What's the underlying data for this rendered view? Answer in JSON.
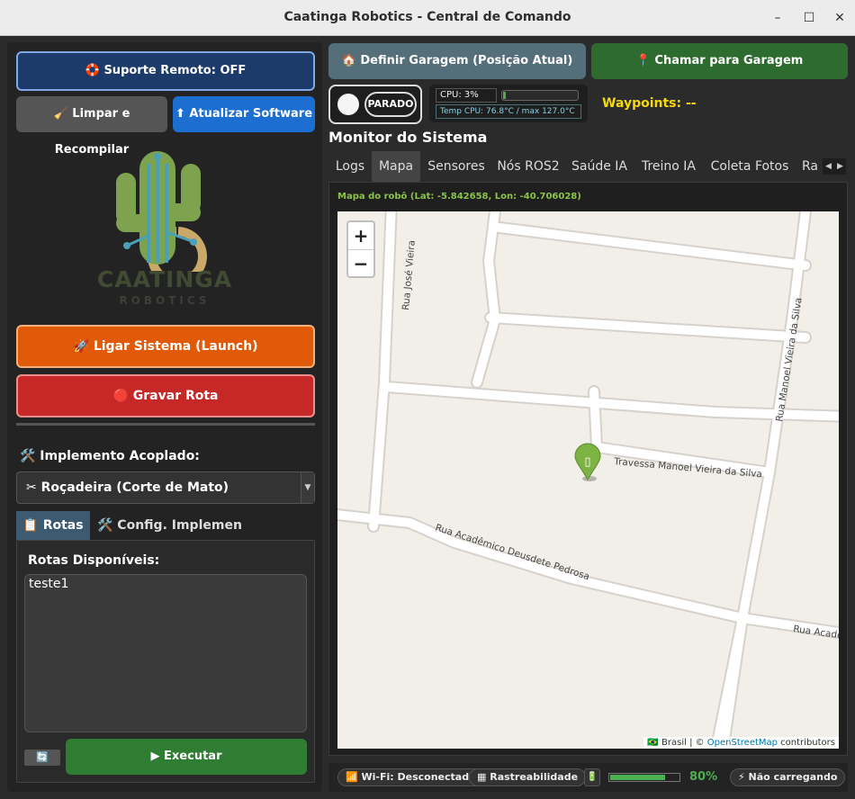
{
  "window": {
    "title": "Caatinga Robotics - Central de Comando",
    "minimize": "–",
    "maximize": "☐",
    "close": "✕"
  },
  "left": {
    "support_button": "🛟 Suporte Remoto: OFF",
    "clean_button": "🧹 Limpar e Recompilar",
    "update_button": "⬆ Atualizar Software",
    "logo": {
      "name": "CAATINGA",
      "sub": "ROBOTICS"
    },
    "launch_button": "🚀 Ligar Sistema (Launch)",
    "record_button": "🔴 Gravar Rota",
    "implement_label": "🛠️ Implemento Acoplado:",
    "implement_selected": "✂ Roçadeira (Corte de Mato)",
    "tabs": [
      {
        "label": "📋 Rotas"
      },
      {
        "label": "🛠️ Config. Implemento"
      }
    ],
    "routes_label": "Rotas Disponíveis:",
    "routes": [
      "teste1"
    ],
    "refresh_icon": "🔄",
    "execute_button": "▶ Executar"
  },
  "top": {
    "set_garage_button": "🏠 Definir Garagem (Posição Atual)",
    "call_garage_button": "📍 Chamar para Garagem"
  },
  "status": {
    "state": "PARADO",
    "cpu_label": "CPU: 3%",
    "cpu_percent": 3,
    "temp_label": "Temp CPU: 76.8°C / max 127.0°C",
    "waypoints": "Waypoints: --"
  },
  "monitor": {
    "title": "Monitor do Sistema",
    "tabs": [
      "Logs",
      "Mapa",
      "Sensores",
      "Nós ROS2",
      "Saúde IA",
      "Treino IA",
      "Coleta Fotos",
      "Ra"
    ],
    "active_tab": "Mapa",
    "scroll_left": "◀",
    "scroll_right": "▶"
  },
  "map": {
    "caption": "Mapa do robô (Lat: -5.842658, Lon: -40.706028)",
    "latitude": -5.842658,
    "longitude": -40.706028,
    "zoom_in": "+",
    "zoom_out": "−",
    "marker_glyph": "▯",
    "streets": {
      "s1": "Rua José Vieira",
      "s2": "Rua Manoel Vieira da Silva",
      "s3": "Travessa Manoel Vieira da Silva",
      "s4": "Rua Acadêmico Deusdete Pedrosa",
      "s5": "Rua Acade"
    },
    "attribution": {
      "prefix": "🇧🇷 Brasil | © ",
      "link": "OpenStreetMap",
      "suffix": " contributors"
    }
  },
  "statusbar": {
    "wifi": "📶 Wi-Fi: Desconectado",
    "traceability": "▦ Rastreabilidade",
    "battery_icon": "🔋",
    "battery_percent_value": 80,
    "battery_percent": "80%",
    "charging": "⚡ Não carregando"
  },
  "colors": {
    "accent_blue": "#1c6fd1",
    "launch_orange": "#e05a08",
    "record_red": "#c62828",
    "execute_green": "#2e7d32",
    "waypoints_yellow": "#f5d90a",
    "map_marker": "#7cb342"
  }
}
